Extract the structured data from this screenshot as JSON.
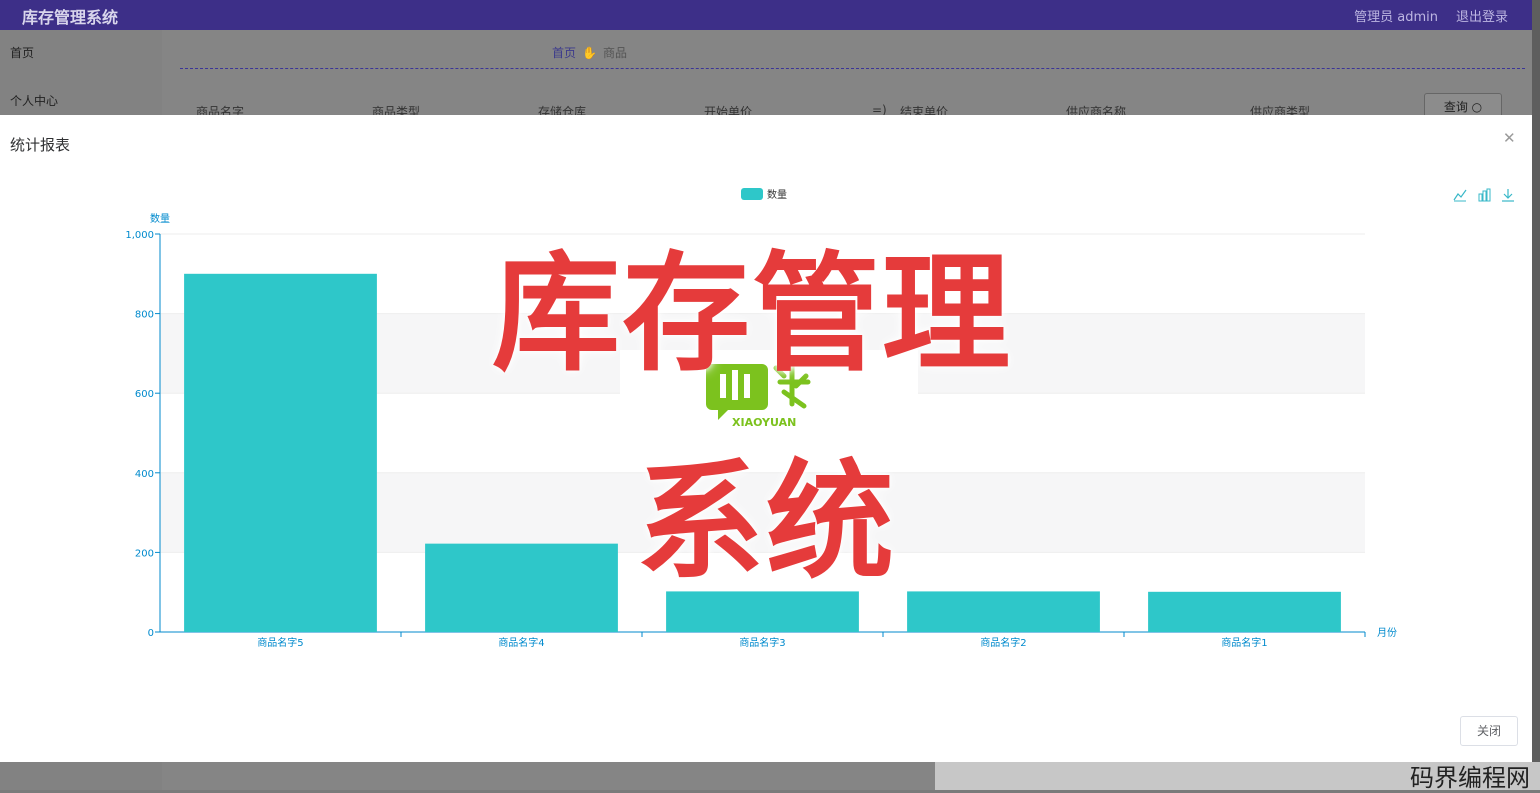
{
  "app": {
    "title": "库存管理系统",
    "user": "管理员 admin",
    "logout": "退出登录"
  },
  "sidebar": {
    "items": [
      {
        "label": "首页"
      },
      {
        "label": "个人中心"
      }
    ]
  },
  "breadcrumb": {
    "home": "首页",
    "current": "商品"
  },
  "filters": [
    {
      "label": "商品名字"
    },
    {
      "label": "商品类型"
    },
    {
      "label": "存储仓库"
    },
    {
      "label": "开始单价"
    },
    {
      "label": "结束单价"
    },
    {
      "label": "供应商名称"
    },
    {
      "label": "供应商类型"
    }
  ],
  "query_button": "查询",
  "modal": {
    "title": "统计报表",
    "close_label": "关闭",
    "toolbox": [
      {
        "icon": "line-chart-icon"
      },
      {
        "icon": "bar-chart-icon"
      },
      {
        "icon": "download-icon"
      }
    ]
  },
  "chart_data": {
    "type": "bar",
    "categories": [
      "商品名字5",
      "商品名字4",
      "商品名字3",
      "商品名字2",
      "商品名字1"
    ],
    "series": [
      {
        "name": "数量",
        "values": [
          900,
          222,
          102,
          102,
          101
        ],
        "color": "#2ec7c9"
      }
    ],
    "ylabel": "数量",
    "xlabel": "月份",
    "ylim": [
      0,
      1000
    ],
    "yticks": [
      "0",
      "200",
      "400",
      "600",
      "800",
      "1,000"
    ],
    "legend": "top-center",
    "grid": true
  },
  "watermark": {
    "line1": "库存管理",
    "line2": "系统",
    "logo_text": "XIAOYUAN"
  },
  "corner_brand": "码界编程网"
}
